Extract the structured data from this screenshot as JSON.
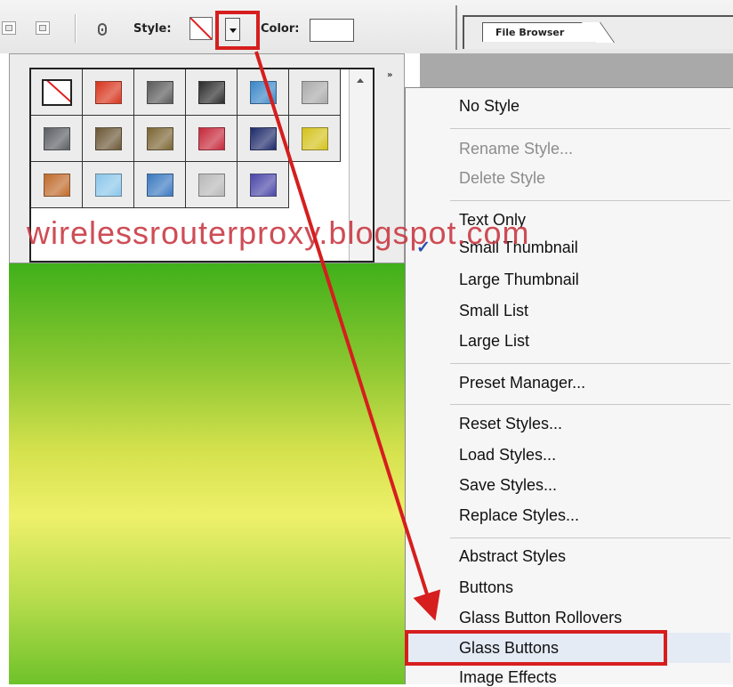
{
  "options_bar": {
    "style_label": "Style:",
    "color_label": "Color:",
    "file_browser_tab": "File Browser",
    "style_dropdown_icon": "chevron-down-icon",
    "link_icon": "chain-link-icon"
  },
  "styles_panel": {
    "flyout_label": "»",
    "swatches": [
      {
        "name": "no-style",
        "color": "#ffffff"
      },
      {
        "name": "red-glow",
        "color": "#d8341c"
      },
      {
        "name": "dark-gray",
        "color": "#5a5a5a"
      },
      {
        "name": "chrome-black",
        "color": "#2b2b2b"
      },
      {
        "name": "blue-glass",
        "color": "#3a86c8"
      },
      {
        "name": "light-gray",
        "color": "#aaaaaa"
      },
      {
        "name": "steel",
        "color": "#5b5e63"
      },
      {
        "name": "bronze-dark",
        "color": "#6a5634"
      },
      {
        "name": "bronze",
        "color": "#7a6432"
      },
      {
        "name": "red-stripe",
        "color": "#c6283a"
      },
      {
        "name": "multicolor",
        "color": "#1e2a6a"
      },
      {
        "name": "yellow-gold",
        "color": "#d4c21a"
      },
      {
        "name": "copper",
        "color": "#c06a2a"
      },
      {
        "name": "sky-blue",
        "color": "#8ac6ea"
      },
      {
        "name": "sunset-blue",
        "color": "#3a78c0"
      },
      {
        "name": "silver-pattern",
        "color": "#b8b8b8"
      },
      {
        "name": "purple-blue",
        "color": "#4a46a8"
      }
    ]
  },
  "watermark": "wirelessrouterproxy.blogspot.com",
  "menu": {
    "check_mark": "✓",
    "items": [
      {
        "label": "No Style",
        "enabled": true
      },
      {
        "label": "Rename Style...",
        "enabled": false
      },
      {
        "label": "Delete Style",
        "enabled": false
      },
      {
        "label": "Text Only",
        "enabled": true
      },
      {
        "label": "Small Thumbnail",
        "enabled": true,
        "checked": true
      },
      {
        "label": "Large Thumbnail",
        "enabled": true
      },
      {
        "label": "Small List",
        "enabled": true
      },
      {
        "label": "Large List",
        "enabled": true
      },
      {
        "label": "Preset Manager...",
        "enabled": true
      },
      {
        "label": "Reset Styles...",
        "enabled": true
      },
      {
        "label": "Load Styles...",
        "enabled": true
      },
      {
        "label": "Save Styles...",
        "enabled": true
      },
      {
        "label": "Replace Styles...",
        "enabled": true
      },
      {
        "label": "Abstract Styles",
        "enabled": true
      },
      {
        "label": "Buttons",
        "enabled": true
      },
      {
        "label": "Glass Button Rollovers",
        "enabled": true
      },
      {
        "label": "Glass Buttons",
        "enabled": true,
        "highlighted": true
      },
      {
        "label": "Image Effects",
        "enabled": true
      }
    ]
  },
  "colors": {
    "annotation_red": "#d61e1e",
    "check_blue": "#2a4fb0",
    "canvas_green": "#3fb01a",
    "canvas_yellow": "#eef06a"
  }
}
